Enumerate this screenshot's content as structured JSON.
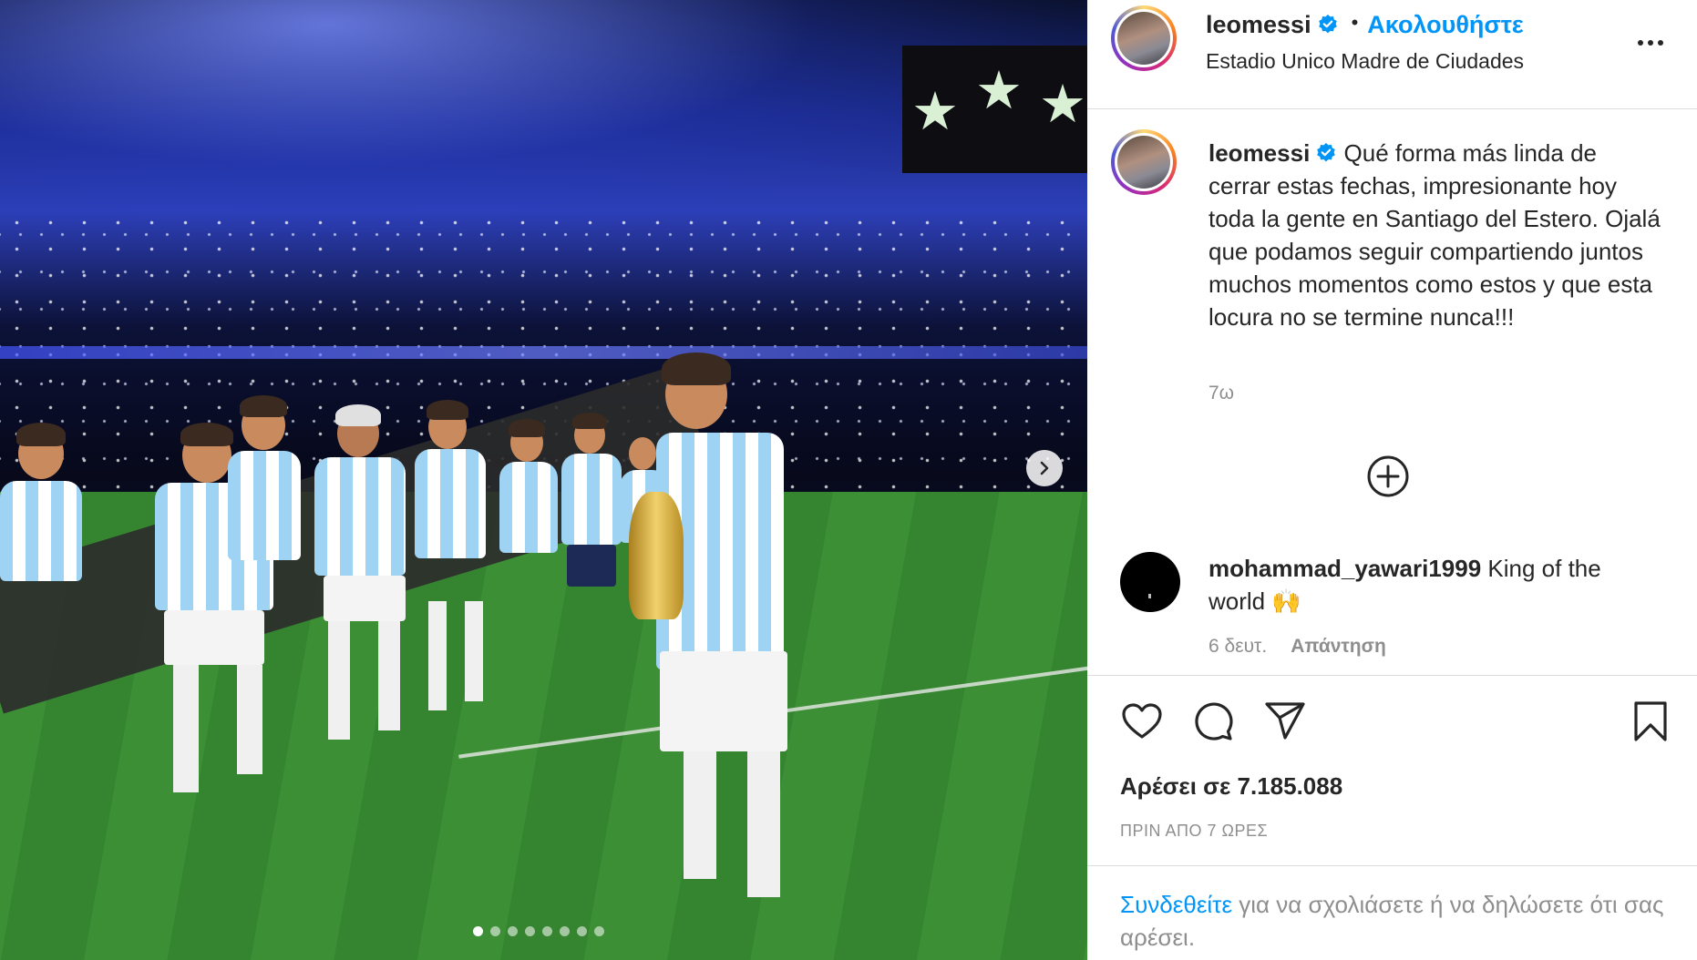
{
  "post": {
    "username": "leomessi",
    "follow_label": "Ακολουθήστε",
    "separator": "•",
    "location": "Estadio Unico Madre de Ciudades",
    "caption": "Qué forma más linda de cerrar estas fechas, impresionante hoy toda la gente en Santiago del Estero. Ojalá que podamos seguir compartiendo juntos muchos momentos como estos y que esta locura no se termine nunca!!!",
    "caption_time": "7ω",
    "likes": "Αρέσει σε 7.185.088",
    "posted_ago": "ΠΡΙΝ ΑΠΟ 7 ΩΡΕΣ"
  },
  "comment": {
    "username": "mohammad_yawari1999",
    "text": "King of the world 🙌",
    "time": "6 δευτ.",
    "reply_label": "Απάντηση"
  },
  "login_prompt": {
    "link": "Συνδεθείτε",
    "rest": " για να σχολιάσετε ή να δηλώσετε ότι σας αρέσει."
  },
  "carousel": {
    "total": 8,
    "active_index": 0
  },
  "colors": {
    "accent": "#0095f6",
    "muted": "#8e8e8e",
    "text": "#262626"
  },
  "icons": [
    "verified-badge-icon",
    "more-options-icon",
    "add-circle-icon",
    "heart-icon",
    "comment-icon",
    "share-icon",
    "bookmark-icon",
    "chevron-right-icon"
  ]
}
